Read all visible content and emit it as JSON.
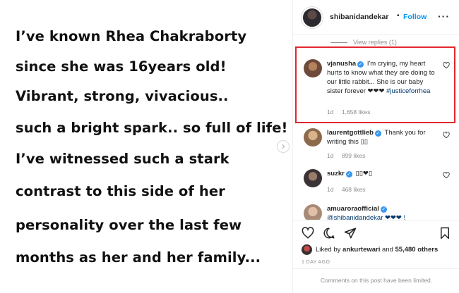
{
  "post_image": {
    "lines": [
      "I’ve known Rhea Chakraborty",
      "since she was 16years old!",
      "Vibrant, strong, vivacious..",
      "such a bright spark.. so full of life!",
      "I’ve witnessed such a stark",
      "contrast to this side of her",
      "personality over the last few",
      "months as her and her family..."
    ]
  },
  "header": {
    "username": "shibanidandekar",
    "dot": "•",
    "follow_label": "Follow",
    "more_label": "···"
  },
  "view_replies": "View replies (1)",
  "comments": [
    {
      "username": "vjanusha",
      "verified": true,
      "text": "I'm crying, my heart hurts to know what they are doing to our little rabbit... She is our baby sister forever ❤❤❤",
      "hashtag": "#justiceforrhea",
      "time": "1d",
      "likes": "1,658 likes",
      "highlighted": true
    },
    {
      "username": "laurentgottlieb",
      "verified": true,
      "text": "Thank you for writing this ▯▯",
      "time": "1d",
      "likes": "899 likes"
    },
    {
      "username": "suzkr",
      "verified": true,
      "text": "▯▯❤▯",
      "time": "1d",
      "likes": "468 likes"
    },
    {
      "username": "amuaroraofficial",
      "verified": true,
      "text": "@shibanidandekar ❤❤❤ !",
      "mention": "@shibanidandekar"
    }
  ],
  "actions": {
    "liked_by_prefix": "Liked by",
    "liked_by_user": "ankurtewari",
    "liked_by_and": "and",
    "liked_by_count": "55,480 others",
    "date": "1 DAY AGO",
    "limited": "Comments on this post have been limited."
  },
  "colors": {
    "accent_blue": "#0095f6",
    "verified": "#3897f0",
    "highlight_border": "#e3262d",
    "hashtag": "#00376b",
    "muted": "#8e8e8e"
  }
}
